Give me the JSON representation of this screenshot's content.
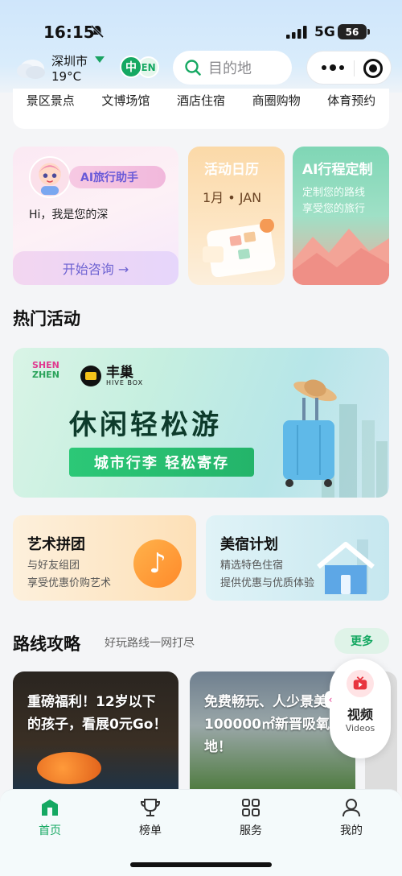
{
  "status": {
    "time": "16:15",
    "network": "5G",
    "battery": "56"
  },
  "header": {
    "city": "深圳市",
    "temperature": "19°C",
    "lang_zh": "中",
    "lang_en": "EN",
    "search_placeholder": "目的地"
  },
  "categories": [
    "景区景点",
    "文博场馆",
    "酒店住宿",
    "商圈购物",
    "体育预约"
  ],
  "features": {
    "ai": {
      "badge": "AI旅行助手",
      "greeting": "Hi，我是您的深",
      "button": "开始咨询 →"
    },
    "calendar": {
      "title": "活动日历",
      "date": "1月 • JAN"
    },
    "trip": {
      "title": "AI行程定制",
      "line1": "定制您的路线",
      "line2": "享受您的旅行"
    }
  },
  "hot": {
    "title": "热门活动",
    "banner": {
      "logo_line1": "SHEN",
      "logo_line2": "ZHEN",
      "hive_name": "丰巢",
      "hive_sub": "HIVE BOX",
      "title": "休闲轻松游",
      "ribbon": "城市行李  轻松寄存"
    },
    "art": {
      "title": "艺术拼团",
      "line1": "与好友组团",
      "line2": "享受优惠价购艺术"
    },
    "stay": {
      "title": "美宿计划",
      "line1": "精选特色住宿",
      "line2": "提供优惠与优质体验"
    }
  },
  "routes": {
    "title": "路线攻略",
    "subtitle": "好玩路线一网打尽",
    "more": "更多",
    "cards": [
      {
        "text": "重磅福利！12岁以下的孩子，看展0元Go！"
      },
      {
        "text": "免费畅玩、人少景美，100000㎡新晋吸氧圣地！"
      }
    ]
  },
  "video_float": {
    "label": "视频",
    "label_en": "Videos"
  },
  "tabs": [
    {
      "label": "首页",
      "active": true,
      "icon": "home-icon"
    },
    {
      "label": "榜单",
      "active": false,
      "icon": "trophy-icon"
    },
    {
      "label": "服务",
      "active": false,
      "icon": "grid-icon"
    },
    {
      "label": "我的",
      "active": false,
      "icon": "user-icon"
    }
  ],
  "colors": {
    "accent": "#15a862",
    "tab_bg": "#f4fafb"
  }
}
